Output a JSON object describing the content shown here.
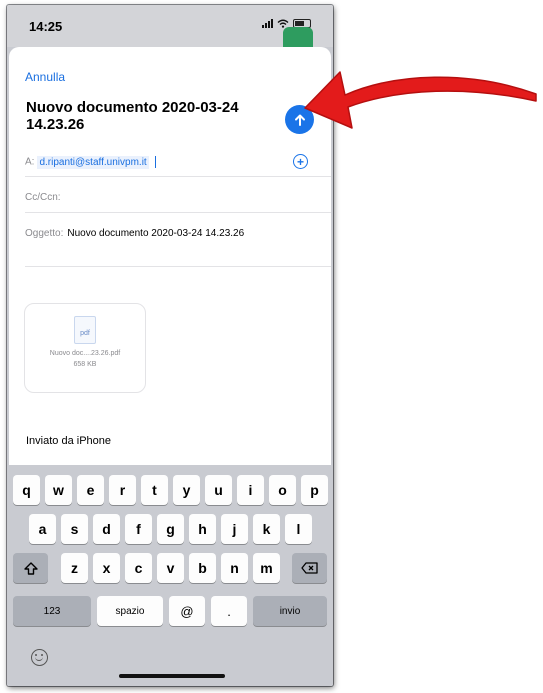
{
  "status": {
    "time": "14:25"
  },
  "compose": {
    "cancel_label": "Annulla",
    "title": "Nuovo documento 2020-03-24 14.23.26",
    "to_label": "A:",
    "to_value": "d.ripanti@staff.univpm.it",
    "cc_label": "Cc/Ccn:",
    "subject_label": "Oggetto:",
    "subject_value": "Nuovo documento 2020-03-24 14.23.26",
    "attachment": {
      "type": "pdf",
      "name": "Nuovo doc....23.26.pdf",
      "size": "658 KB"
    },
    "signature": "Inviato da iPhone"
  },
  "keyboard": {
    "row1": [
      "q",
      "w",
      "e",
      "r",
      "t",
      "y",
      "u",
      "i",
      "o",
      "p"
    ],
    "row2": [
      "a",
      "s",
      "d",
      "f",
      "g",
      "h",
      "j",
      "k",
      "l"
    ],
    "row3": [
      "z",
      "x",
      "c",
      "v",
      "b",
      "n",
      "m"
    ],
    "numbers_label": "123",
    "space_label": "spazio",
    "at_label": "@",
    "dot_label": ".",
    "return_label": "invio"
  },
  "colors": {
    "accent": "#1a74e8",
    "arrow": "#e31b1b"
  },
  "icons": [
    "send-icon",
    "add-contact-icon",
    "pdf-file-icon",
    "shift-icon",
    "backspace-icon",
    "emoji-icon",
    "pointer-arrow-icon"
  ]
}
